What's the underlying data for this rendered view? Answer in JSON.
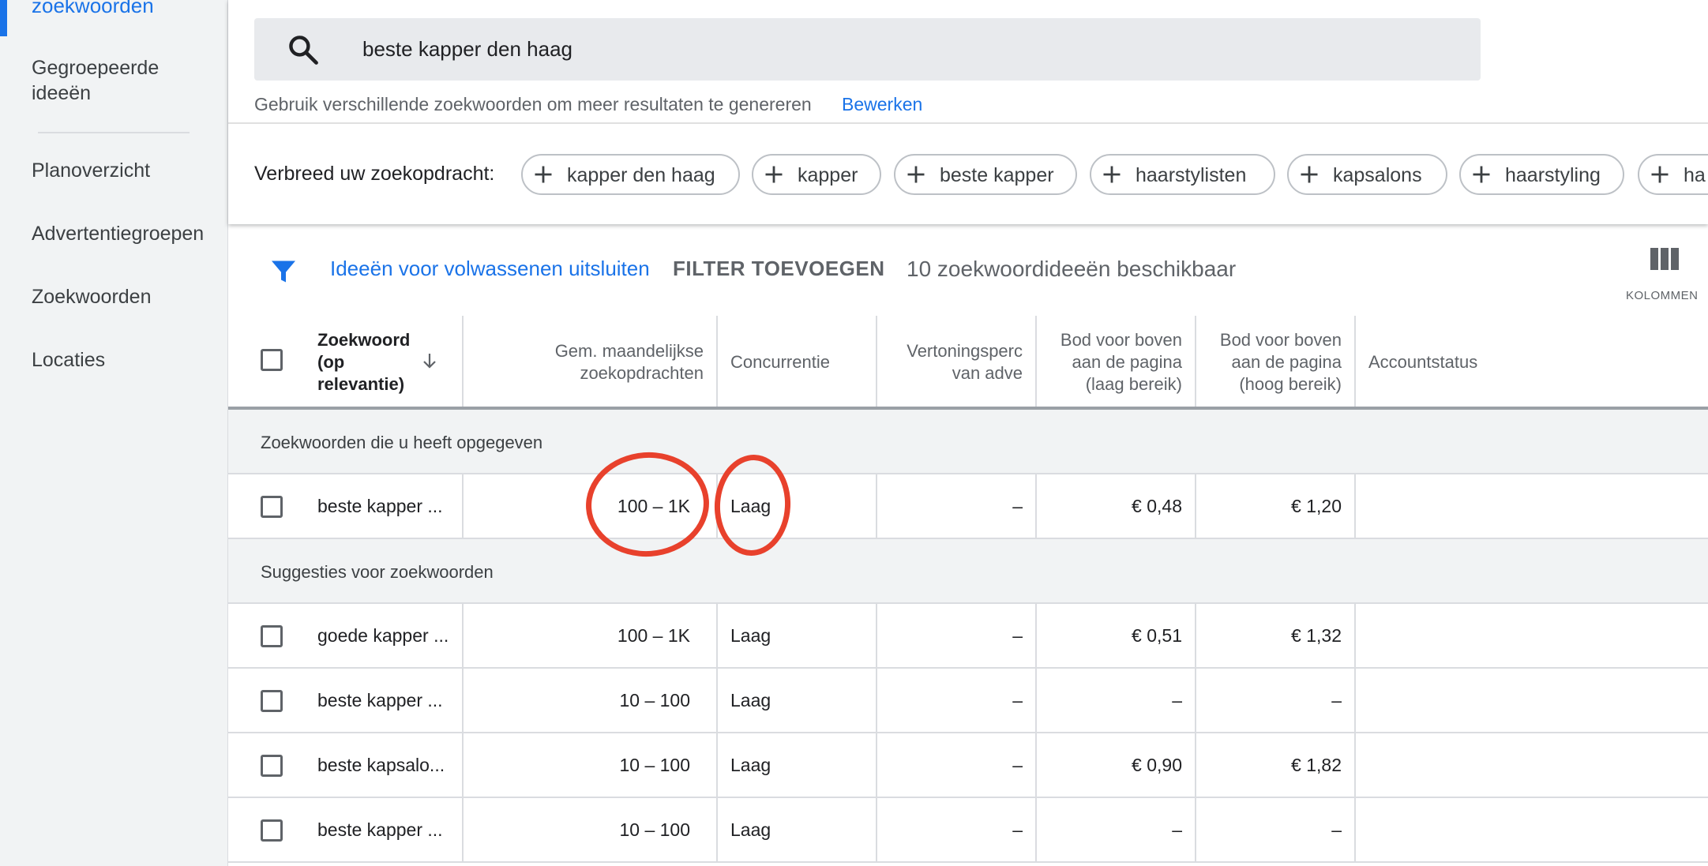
{
  "sidebar": {
    "active_item": "zoekwoorden",
    "items": [
      "Gegroepeerde ideeën",
      "Planoverzicht",
      "Advertentiegroepen",
      "Zoekwoorden",
      "Locaties"
    ]
  },
  "search": {
    "query": "beste kapper den haag",
    "hint": "Gebruik verschillende zoekwoorden om meer resultaten te genereren",
    "edit_link": "Bewerken"
  },
  "broaden": {
    "label": "Verbreed uw zoekopdracht:",
    "chips": [
      "kapper den haag",
      "kapper",
      "beste kapper",
      "haarstylisten",
      "kapsalons",
      "haarstyling",
      "ha"
    ]
  },
  "filter_bar": {
    "adult_filter": "Ideeën voor volwassenen uitsluiten",
    "add_filter": "FILTER TOEVOEGEN",
    "ideas_count": "10 zoekwoordideeën beschikbaar",
    "columns_label": "KOLOMMEN"
  },
  "table": {
    "headers": {
      "keyword": "Zoekwoord (op relevantie)",
      "monthly": "Gem. maandelijkse zoekopdrachten",
      "competition": "Concurrentie",
      "impression_share": "Vertoningsperc van adve",
      "bid_low": "Bod voor boven aan de pagina (laag bereik)",
      "bid_high": "Bod voor boven aan de pagina (hoog bereik)",
      "account_status": "Accountstatus"
    },
    "section_provided": "Zoekwoorden die u heeft opgegeven",
    "provided_rows": [
      {
        "keyword": "beste kapper ...",
        "monthly": "100 – 1K",
        "competition": "Laag",
        "impression_share": "–",
        "bid_low": "€ 0,48",
        "bid_high": "€ 1,20"
      }
    ],
    "section_suggestions": "Suggesties voor zoekwoorden",
    "suggestion_rows": [
      {
        "keyword": "goede kapper ...",
        "monthly": "100 – 1K",
        "competition": "Laag",
        "impression_share": "–",
        "bid_low": "€ 0,51",
        "bid_high": "€ 1,32"
      },
      {
        "keyword": "beste kapper ...",
        "monthly": "10 – 100",
        "competition": "Laag",
        "impression_share": "–",
        "bid_low": "–",
        "bid_high": "–"
      },
      {
        "keyword": "beste kapsalo...",
        "monthly": "10 – 100",
        "competition": "Laag",
        "impression_share": "–",
        "bid_low": "€ 0,90",
        "bid_high": "€ 1,82"
      },
      {
        "keyword": "beste kapper ...",
        "monthly": "10 – 100",
        "competition": "Laag",
        "impression_share": "–",
        "bid_low": "–",
        "bid_high": "–"
      }
    ]
  },
  "annotation_color": "#e8412c"
}
